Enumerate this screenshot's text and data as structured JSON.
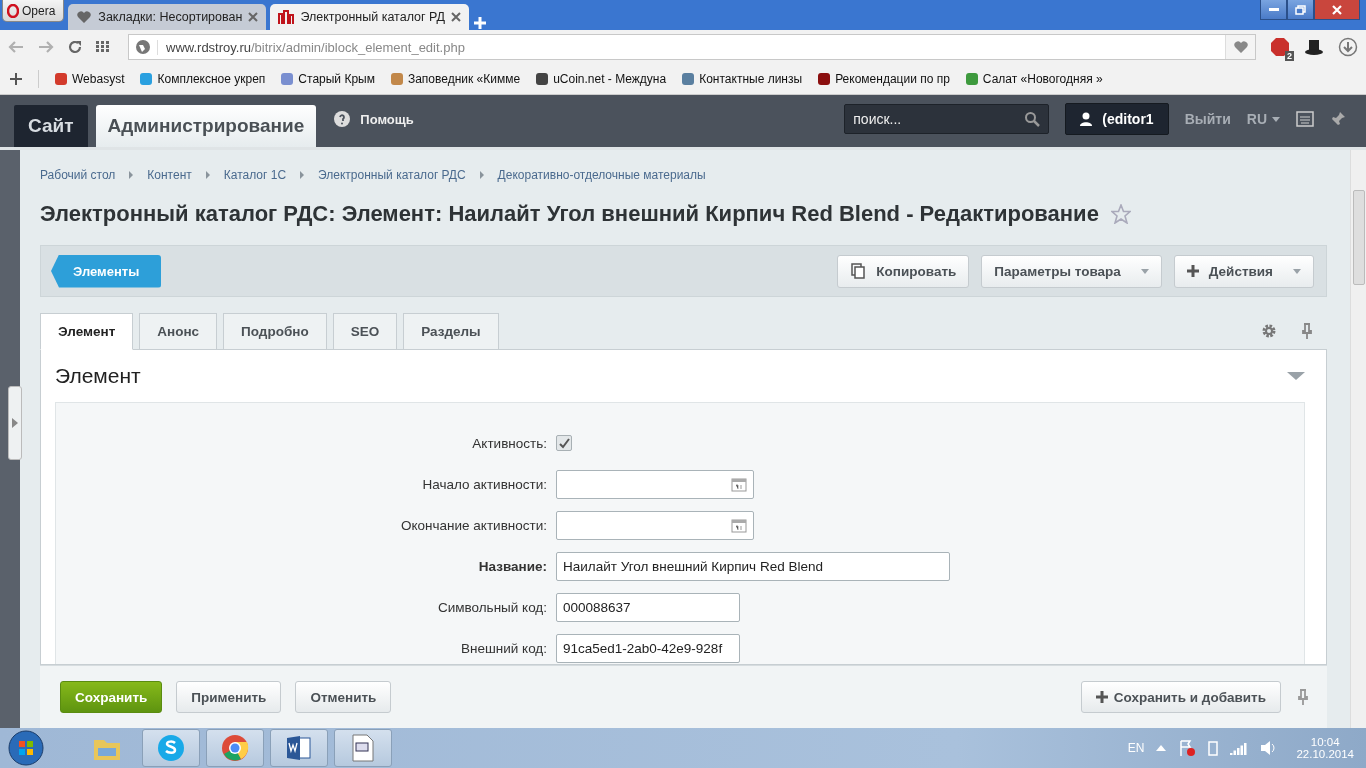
{
  "browser": {
    "menu_label": "Opera",
    "tabs": [
      {
        "title": "Закладки: Несортирован",
        "selected": false,
        "kind": "heart"
      },
      {
        "title": "Электронный каталог РД",
        "selected": true,
        "kind": "site"
      }
    ],
    "address": {
      "host": "www.rdstroy.ru",
      "path": "/bitrix/admin/iblock_element_edit.php"
    },
    "adblock_count": "2",
    "bookmarks": [
      {
        "title": "Webasyst",
        "color": "#d33b2c"
      },
      {
        "title": "Комплексное укреп",
        "color": "#2aa0e0"
      },
      {
        "title": "Старый Крым",
        "color": "#7a8fd0"
      },
      {
        "title": "Заповедник «Кимме",
        "color": "#c2884a"
      },
      {
        "title": "uCoin.net - Междуна",
        "color": "#444444"
      },
      {
        "title": "Контактные линзы",
        "color": "#5a7fa0"
      },
      {
        "title": "Рекомендации по пр",
        "color": "#8b0f0f"
      },
      {
        "title": "Салат «Новогодняя »",
        "color": "#3e9a3e"
      }
    ]
  },
  "admin": {
    "site_tab": "Сайт",
    "admin_tab": "Администрирование",
    "help": "Помощь",
    "search_placeholder": "поиск...",
    "user": "(editor1",
    "logout": "Выйти",
    "lang": "RU"
  },
  "breadcrumbs": [
    "Рабочий стол",
    "Контент",
    "Каталог 1С",
    "Электронный каталог РДС",
    "Декоративно-отделочные материалы"
  ],
  "title": "Электронный каталог РДС: Элемент: Наилайт Угол внешний Кирпич Red Blend - Редактирование",
  "elements_button": "Элементы",
  "toolbar_buttons": [
    {
      "label": "Копировать",
      "kind": "copy"
    },
    {
      "label": "Параметры товара",
      "kind": "dropdown"
    },
    {
      "label": "Действия",
      "kind": "add-dropdown"
    }
  ],
  "tabs": [
    {
      "label": "Элемент",
      "selected": true
    },
    {
      "label": "Анонс",
      "selected": false
    },
    {
      "label": "Подробно",
      "selected": false
    },
    {
      "label": "SEO",
      "selected": false
    },
    {
      "label": "Разделы",
      "selected": false
    }
  ],
  "section": {
    "title": "Элемент",
    "expanded": true
  },
  "fields": [
    {
      "label": "Активность:",
      "kind": "checkbox",
      "checked": true,
      "bold": false
    },
    {
      "label": "Начало активности:",
      "kind": "date",
      "bold": false
    },
    {
      "label": "Окончание активности:",
      "kind": "date",
      "bold": false
    },
    {
      "label": "Название:",
      "kind": "name",
      "value": "Наилайт Угол внешний Кирпич Red Blend",
      "bold": true
    },
    {
      "label": "Символьный код:",
      "kind": "code",
      "value": "000088637",
      "bold": false
    },
    {
      "label": "Внешний код:",
      "kind": "code",
      "value": "91ca5ed1-2ab0-42e9-928f",
      "bold": false
    }
  ],
  "footer_buttons": [
    {
      "label": "Сохранить",
      "kind": "primary"
    },
    {
      "label": "Применить",
      "kind": "plain"
    },
    {
      "label": "Отменить",
      "kind": "plain"
    },
    {
      "label": "Сохранить и добавить",
      "kind": "add"
    }
  ],
  "taskbar": {
    "apps": [
      {
        "kind": "folder",
        "selected": false
      },
      {
        "kind": "skype",
        "selected": true
      },
      {
        "kind": "chrome",
        "selected": true
      },
      {
        "kind": "word",
        "selected": true
      },
      {
        "kind": "document",
        "selected": true
      }
    ],
    "lang": "EN",
    "time": "10:04",
    "date": "22.10.2014"
  }
}
